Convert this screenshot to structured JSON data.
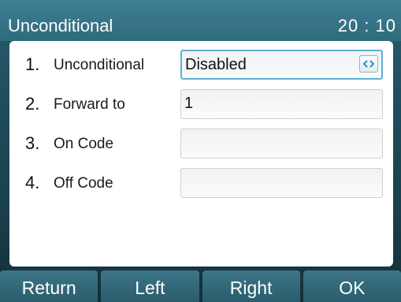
{
  "header": {
    "title": "Unconditional",
    "time": "20 : 10"
  },
  "form": {
    "rows": [
      {
        "number": "1.",
        "label": "Unconditional",
        "value": "Disabled",
        "control": "switch"
      },
      {
        "number": "2.",
        "label": "Forward to",
        "value": "1"
      },
      {
        "number": "3.",
        "label": "On Code",
        "value": ""
      },
      {
        "number": "4.",
        "label": "Off Code",
        "value": ""
      }
    ],
    "switch_icon": "left-right-arrows-icon"
  },
  "softkeys": [
    "Return",
    "Left",
    "Right",
    "OK"
  ],
  "colors": {
    "title_bar": "#2f6b7d",
    "active_border": "#5fb0d6",
    "softkey": "#2a5c6c"
  }
}
